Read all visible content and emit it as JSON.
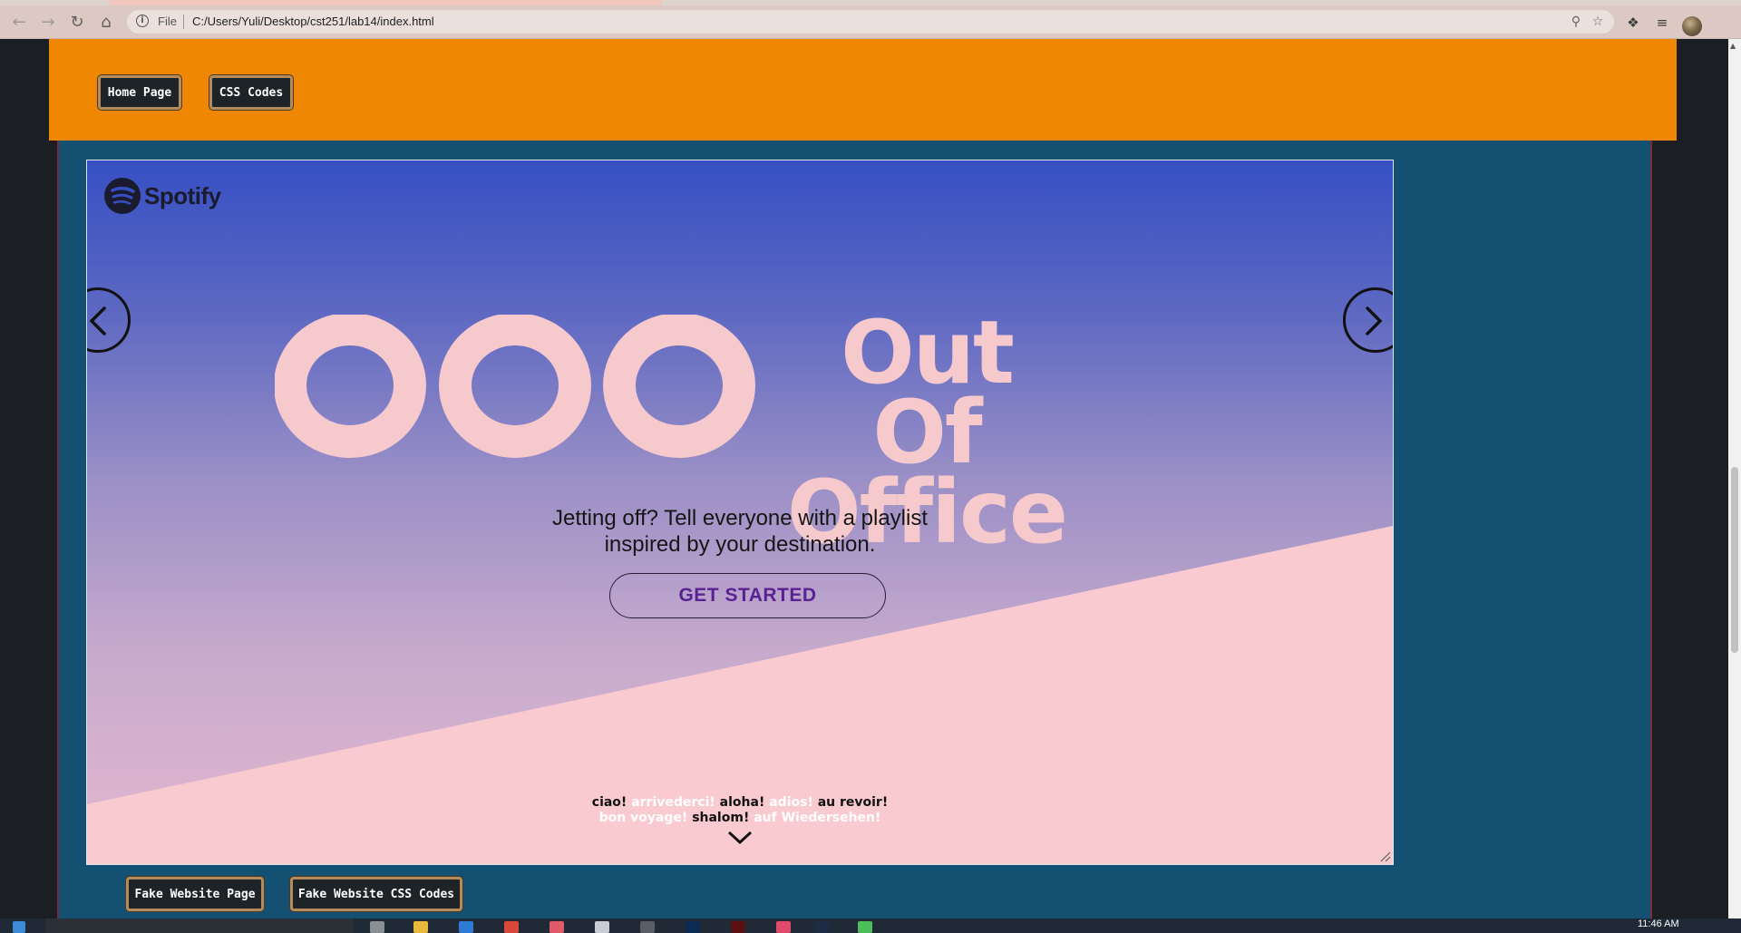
{
  "browser": {
    "url_scheme_label": "File",
    "url": "C:/Users/Yuli/Desktop/cst251/lab14/index.html",
    "icons": [
      "back-icon",
      "forward-icon",
      "reload-icon",
      "home-icon",
      "info-icon",
      "zoom-icon",
      "star-icon",
      "extensions-icon",
      "reading-list-icon",
      "profile-avatar"
    ]
  },
  "header": {
    "nav": [
      {
        "label": "Home Page"
      },
      {
        "label": "CSS Codes"
      }
    ]
  },
  "banner": {
    "brand": "Spotify",
    "title_line1": "Out Of",
    "title_line2": "Office",
    "tagline_line1": "Jetting off? Tell everyone with a playlist",
    "tagline_line2": "inspired by your destination.",
    "cta": "GET STARTED",
    "goodbyes_line1": [
      {
        "text": "ciao!",
        "tone": "dark"
      },
      {
        "text": "arrivederci!",
        "tone": "light"
      },
      {
        "text": "aloha!",
        "tone": "dark"
      },
      {
        "text": "adios!",
        "tone": "light"
      },
      {
        "text": "au revoir!",
        "tone": "dark"
      }
    ],
    "goodbyes_line2": [
      {
        "text": "bon voyage!",
        "tone": "light"
      },
      {
        "text": "shalom!",
        "tone": "dark"
      },
      {
        "text": "auf Wiedersehen!",
        "tone": "light"
      }
    ],
    "colors": {
      "pink": "#f6c9cd",
      "purple_cta": "#5a2193",
      "gradient_top": "#3650c3"
    }
  },
  "footer_nav": [
    {
      "label": "Fake Website Page"
    },
    {
      "label": "Fake Website CSS Codes"
    }
  ],
  "taskbar": {
    "time": "11:46 AM"
  }
}
